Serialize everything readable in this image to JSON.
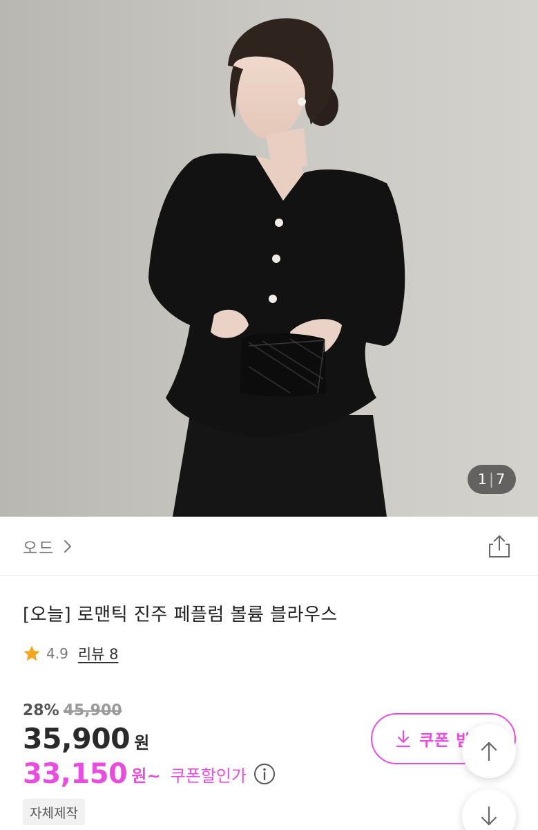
{
  "product_image": {
    "counter_current": "1",
    "counter_total": "7"
  },
  "brand": {
    "name": "오드"
  },
  "product": {
    "title": "[오늘] 로맨틱 진주 페플럼 볼륨 블라우스",
    "rating": "4.9",
    "review_label": "리뷰 8",
    "discount_rate": "28%",
    "original_price": "45,900",
    "sale_price": "35,900",
    "sale_unit": "원",
    "coupon_price": "33,150",
    "coupon_unit": "원~",
    "coupon_label": "쿠폰할인가",
    "tag": "자체제작"
  },
  "coupon_button": {
    "label": "쿠폰 받"
  },
  "colors": {
    "accent": "#e94de0",
    "star": "#f5a623",
    "counter_bg": "#373737"
  },
  "icons": {
    "brand_chevron": "chevron-right-icon",
    "share": "share-icon",
    "star": "star-icon",
    "info": "info-icon",
    "download": "download-icon",
    "scroll_up": "arrow-up-icon",
    "scroll_down": "arrow-down-icon"
  }
}
